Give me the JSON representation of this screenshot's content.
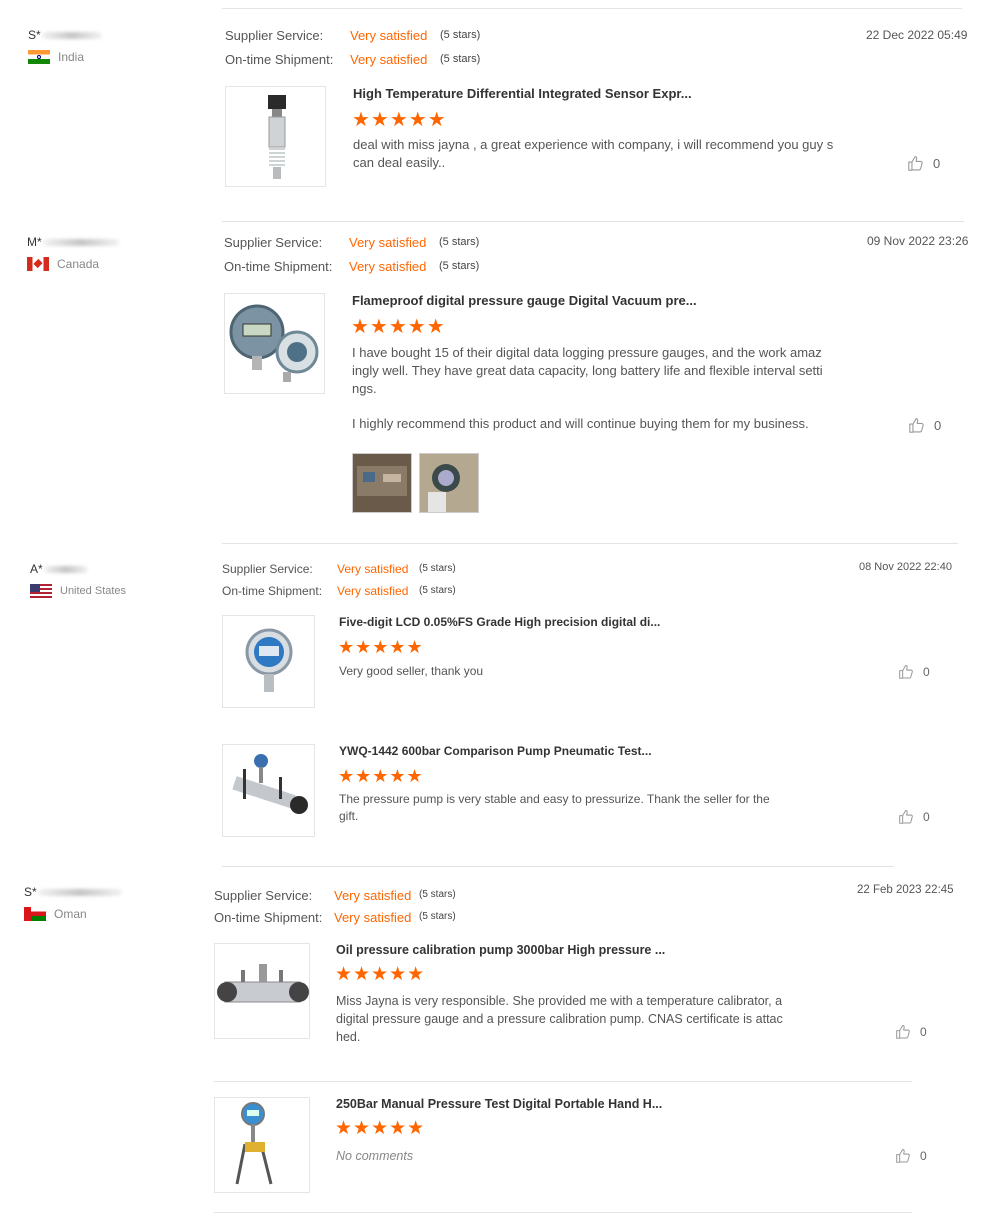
{
  "reviews": [
    {
      "buyer": "S*",
      "country": "India",
      "flag": "flag-india",
      "date": "22 Dec 2022 05:49",
      "supplier_label": "Supplier Service:",
      "supplier_value": "Very satisfied",
      "supplier_stars": "(5 stars)",
      "shipment_label": "On-time Shipment:",
      "shipment_value": "Very satisfied",
      "shipment_stars": "(5 stars)",
      "items": [
        {
          "title": "High Temperature Differential Integrated Sensor Expr...",
          "rating": 5,
          "comment": "deal with miss jayna , a great experience with company, i will recommend you guy s can deal easily..",
          "likes": "0"
        }
      ]
    },
    {
      "buyer": "M*",
      "country": "Canada",
      "flag": "flag-canada",
      "date": "09 Nov 2022 23:26",
      "supplier_label": "Supplier Service:",
      "supplier_value": "Very satisfied",
      "supplier_stars": "(5 stars)",
      "shipment_label": "On-time Shipment:",
      "shipment_value": "Very satisfied",
      "shipment_stars": "(5 stars)",
      "items": [
        {
          "title": "Flameproof digital pressure gauge Digital Vacuum pre...",
          "rating": 5,
          "comment": "I have bought 15 of their digital data logging pressure gauges, and the work amaz ingly well. They have great data capacity, long battery life and flexible interval setti ngs.",
          "comment2": "I highly recommend this product and will continue buying them for my business.",
          "likes": "0"
        }
      ]
    },
    {
      "buyer": "A*",
      "country": "United States",
      "flag": "flag-us",
      "date": "08 Nov 2022 22:40",
      "supplier_label": "Supplier Service:",
      "supplier_value": "Very satisfied",
      "supplier_stars": "(5 stars)",
      "shipment_label": "On-time Shipment:",
      "shipment_value": "Very satisfied",
      "shipment_stars": "(5 stars)",
      "items": [
        {
          "title": "Five-digit LCD 0.05%FS Grade High precision digital di...",
          "rating": 5,
          "comment": "Very good seller, thank you",
          "likes": "0"
        },
        {
          "title": "YWQ-1442 600bar Comparison Pump Pneumatic Test...",
          "rating": 5,
          "comment": "The pressure pump is very stable and easy to pressurize. Thank the seller for the gift.",
          "likes": "0"
        }
      ]
    },
    {
      "buyer": "S*",
      "country": "Oman",
      "flag": "flag-oman",
      "date": "22 Feb 2023 22:45",
      "supplier_label": "Supplier Service:",
      "supplier_value": "Very satisfied",
      "supplier_stars": "(5 stars)",
      "shipment_label": "On-time Shipment:",
      "shipment_value": "Very satisfied",
      "shipment_stars": "(5 stars)",
      "items": [
        {
          "title": "Oil pressure calibration pump 3000bar High pressure ...",
          "rating": 5,
          "comment": "Miss Jayna is very responsible. She provided me with a temperature calibrator, a digital pressure gauge and a pressure calibration pump. CNAS certificate is attac hed.",
          "likes": "0"
        },
        {
          "title": "250Bar Manual Pressure Test Digital Portable Hand H...",
          "rating": 5,
          "comment": "No comments",
          "likes": "0"
        }
      ]
    }
  ],
  "colors": {
    "accent": "#ff6600",
    "text": "#333333",
    "muted": "#888888",
    "divider": "#e3e3e3"
  },
  "icons": {
    "like": "thumbs-up-icon",
    "star": "star-icon"
  }
}
